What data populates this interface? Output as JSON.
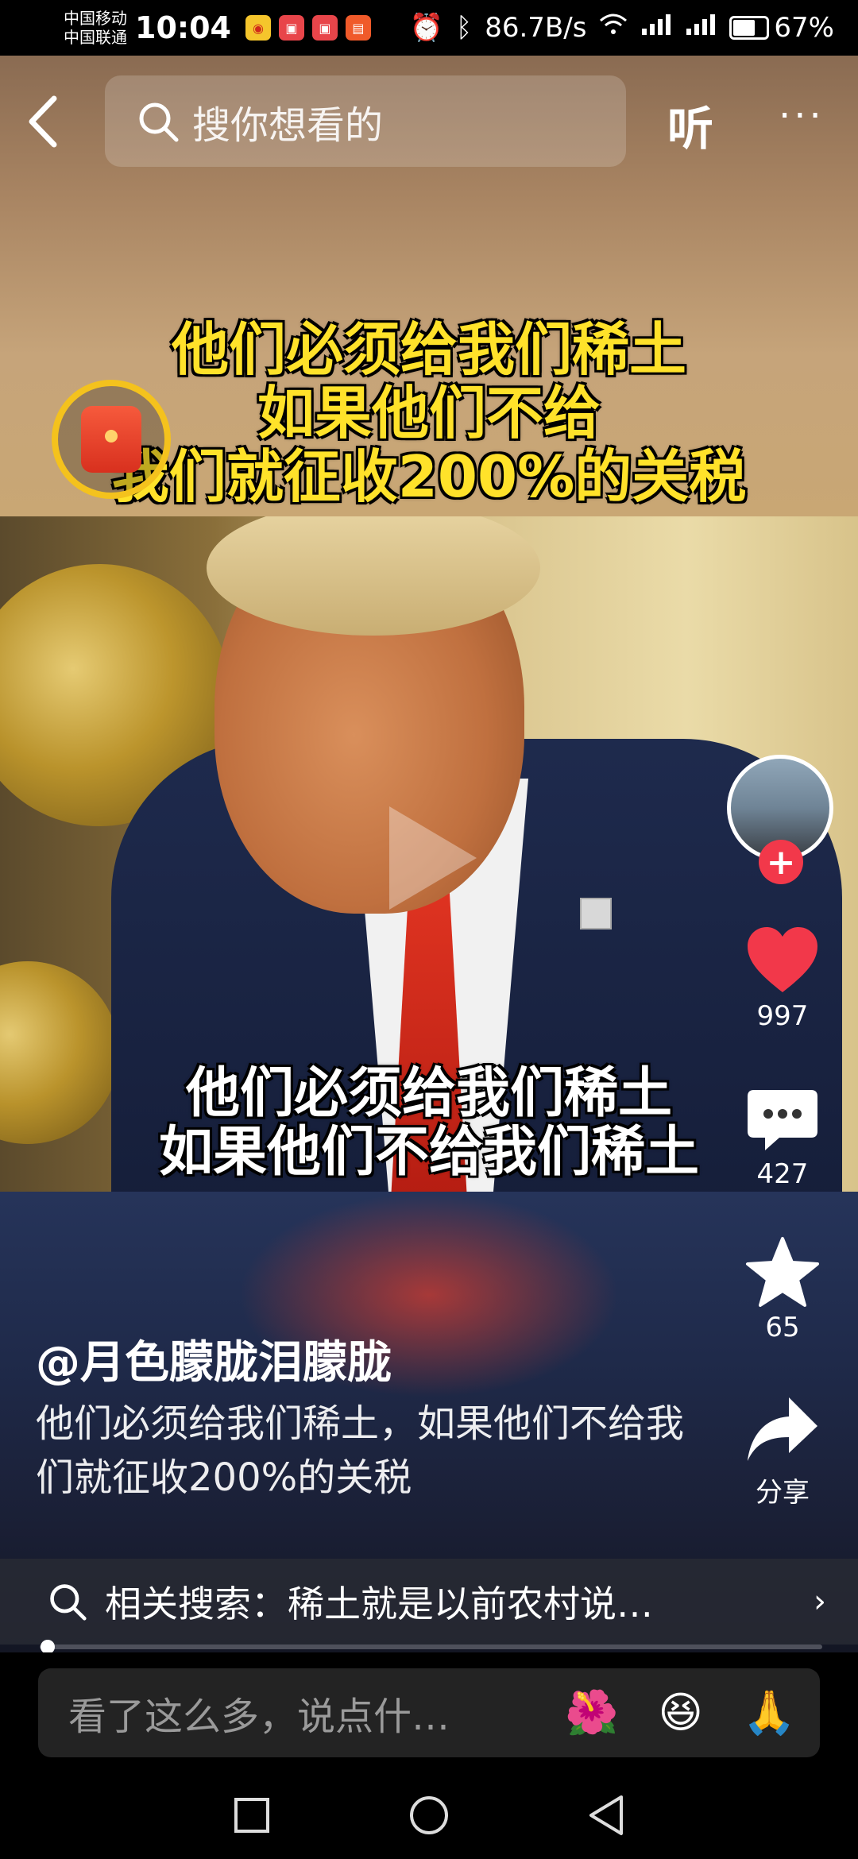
{
  "status_bar": {
    "carrier_1": "中国移动",
    "carrier_2": "中国联通",
    "time": "10:04",
    "net_speed": "86.7B/s",
    "battery": "67%"
  },
  "top_nav": {
    "search_placeholder": "搜你想看的",
    "listen_label": "听",
    "more_label": "···"
  },
  "video": {
    "top_caption_line1": "他们必须给我们稀土",
    "top_caption_line2": "如果他们不给",
    "top_caption_line3": "我们就征收200%的关税",
    "bottom_caption_line1": "他们必须给我们稀土",
    "bottom_caption_line2": "如果他们不给我们稀土"
  },
  "rail": {
    "likes": "997",
    "comments": "427",
    "favorites": "65",
    "share_label": "分享",
    "follow_label": "+"
  },
  "post": {
    "author": "@月色朦胧泪朦胧",
    "description": "他们必须给我们稀土，如果他们不给我们就征收200%的关税"
  },
  "related": {
    "text": "相关搜索：稀土就是以前农村说…",
    "chevron": "›"
  },
  "comment_bar": {
    "placeholder": "看了这么多，说点什…",
    "emoji_1": "🌺",
    "emoji_2": "😆",
    "emoji_3": "🙏"
  },
  "progress": {
    "played_fraction": 0.01
  }
}
